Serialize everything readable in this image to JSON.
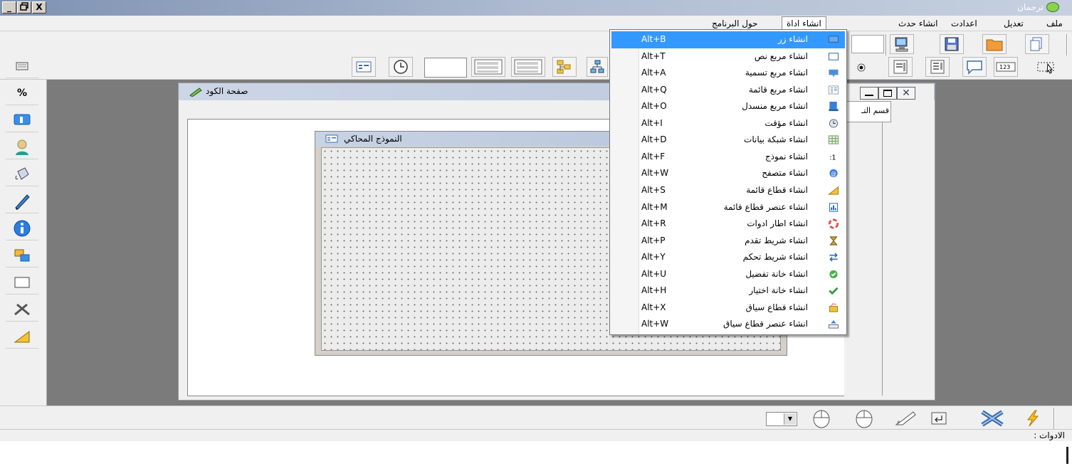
{
  "window": {
    "title": "ترجمان",
    "controls": [
      "_",
      "🗗",
      "X"
    ]
  },
  "menubar": {
    "items": [
      {
        "label": "ملف"
      },
      {
        "label": "تعديل"
      },
      {
        "label": "اعدادت"
      },
      {
        "label": "انشاء حدث"
      },
      {
        "label": "انشاء اداة"
      },
      {
        "label": "حول البرنامج"
      }
    ]
  },
  "code_page": {
    "title": "صفحة الكود",
    "side_tab": "قسم التـ"
  },
  "emulator": {
    "title": "النموذج المحاكي"
  },
  "dropdown": {
    "items": [
      {
        "label": "انشاء زر",
        "shortcut": "Alt+B",
        "icon": "button-icon",
        "selected": true
      },
      {
        "label": "انشاء مربع نص",
        "shortcut": "Alt+T",
        "icon": "textbox-icon"
      },
      {
        "label": "انشاء مربع تسمية",
        "shortcut": "Alt+A",
        "icon": "label-icon"
      },
      {
        "label": "انشاء مربع قائمة",
        "shortcut": "Alt+Q",
        "icon": "listbox-icon"
      },
      {
        "label": "انشاء مربع منسدل",
        "shortcut": "Alt+O",
        "icon": "combobox-icon"
      },
      {
        "label": "انشاء مؤقت",
        "shortcut": "Alt+I",
        "icon": "timer-icon"
      },
      {
        "label": "انشاء شبكة بيانات",
        "shortcut": "Alt+D",
        "icon": "datagrid-icon"
      },
      {
        "label": "انشاء نموذج",
        "shortcut": "Alt+F",
        "icon": "form-icon"
      },
      {
        "label": "انشاء متصفح",
        "shortcut": "Alt+W",
        "icon": "browser-icon"
      },
      {
        "label": "انشاء قطاع قائمة",
        "shortcut": "Alt+S",
        "icon": "menu-strip-icon"
      },
      {
        "label": "انشاء عنصر قطاع قائمة",
        "shortcut": "Alt+M",
        "icon": "menu-item-icon"
      },
      {
        "label": "انشاء اطار ادوات",
        "shortcut": "Alt+R",
        "icon": "toolbar-frame-icon"
      },
      {
        "label": "انشاء شريط تقدم",
        "shortcut": "Alt+P",
        "icon": "progressbar-icon"
      },
      {
        "label": "انشاء شريط تحكم",
        "shortcut": "Alt+Y",
        "icon": "trackbar-icon"
      },
      {
        "label": "انشاء خانة تفضيل",
        "shortcut": "Alt+U",
        "icon": "radio-icon"
      },
      {
        "label": "انشاء خانة اختيار",
        "shortcut": "Alt+H",
        "icon": "checkbox-icon"
      },
      {
        "label": "انشاء قطاع سياق",
        "shortcut": "Alt+X",
        "icon": "context-strip-icon"
      },
      {
        "label": "انشاء عنصر قطاع سياق",
        "shortcut": "Alt+W",
        "icon": "context-item-icon"
      }
    ]
  },
  "status": {
    "text": "الادوات :"
  },
  "colors": {
    "menu_highlight": "#3399ff",
    "workspace": "#7b7b7b",
    "titlebar": "#aebbd1"
  }
}
